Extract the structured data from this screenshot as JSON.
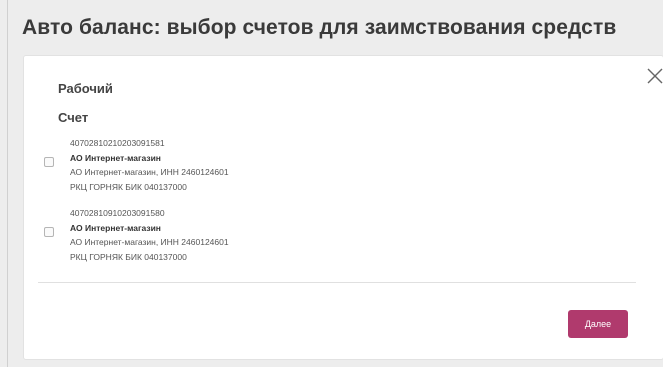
{
  "page": {
    "title": "Авто баланс: выбор счетов для заимствования средств"
  },
  "dialog": {
    "group_title": "Рабочий",
    "list_title": "Счет",
    "accounts": [
      {
        "number": "40702810210203091581",
        "name": "АО Интернет-магазин",
        "details": "АО Интернет-магазин, ИНН 2460124601",
        "bank": "РКЦ ГОРНЯК БИК 040137000",
        "checked": false
      },
      {
        "number": "40702810910203091580",
        "name": "АО Интернет-магазин",
        "details": "АО Интернет-магазин, ИНН 2460124601",
        "bank": "РКЦ ГОРНЯК БИК 040137000",
        "checked": false
      }
    ],
    "next_label": "Далее"
  },
  "colors": {
    "accent": "#b03a6d",
    "background": "#ededed",
    "card": "#ffffff"
  },
  "icons": {
    "close": "close-icon"
  }
}
